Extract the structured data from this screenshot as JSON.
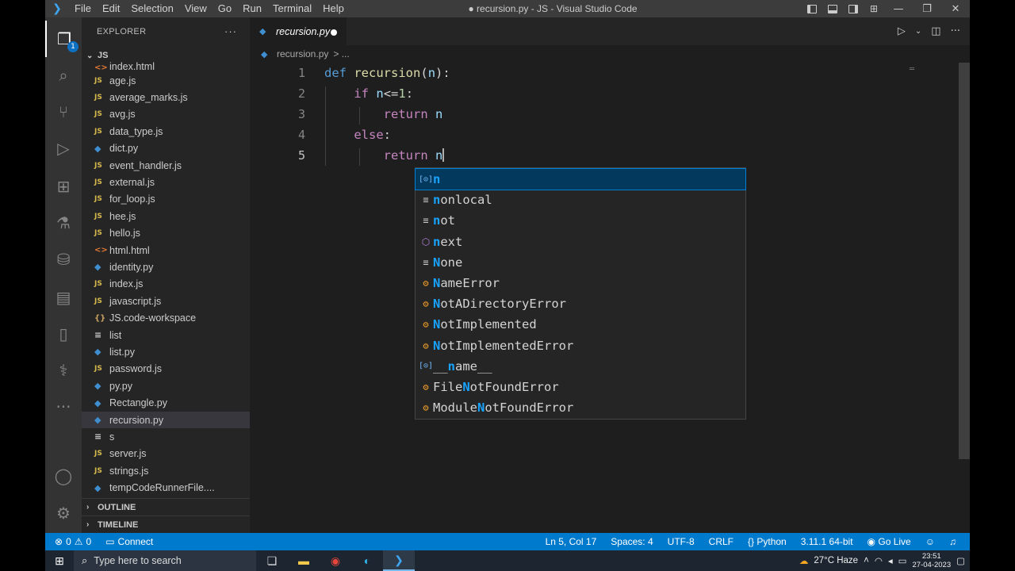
{
  "window": {
    "title": "● recursion.py - JS - Visual Studio Code",
    "menu": [
      "File",
      "Edit",
      "Selection",
      "View",
      "Go",
      "Run",
      "Terminal",
      "Help"
    ]
  },
  "activity_bar": {
    "explorer_badge": "1",
    "items": [
      "files-icon",
      "search-icon",
      "source-control-icon",
      "run-debug-icon",
      "extensions-icon",
      "testing-icon",
      "database-icon",
      "remote-explorer-icon",
      "bookmark-icon",
      "python-icon",
      "more-icon",
      "account-icon",
      "settings-gear-icon"
    ]
  },
  "sidebar": {
    "header": "EXPLORER",
    "folder": "JS",
    "files": [
      {
        "name": "index.html",
        "type": "html"
      },
      {
        "name": "age.js",
        "type": "js"
      },
      {
        "name": "average_marks.js",
        "type": "js"
      },
      {
        "name": "avg.js",
        "type": "js"
      },
      {
        "name": "data_type.js",
        "type": "js"
      },
      {
        "name": "dict.py",
        "type": "py"
      },
      {
        "name": "event_handler.js",
        "type": "js"
      },
      {
        "name": "external.js",
        "type": "js"
      },
      {
        "name": "for_loop.js",
        "type": "js"
      },
      {
        "name": "hee.js",
        "type": "js"
      },
      {
        "name": "hello.js",
        "type": "js"
      },
      {
        "name": "html.html",
        "type": "html"
      },
      {
        "name": "identity.py",
        "type": "py"
      },
      {
        "name": "index.js",
        "type": "js"
      },
      {
        "name": "javascript.js",
        "type": "js"
      },
      {
        "name": "JS.code-workspace",
        "type": "ws"
      },
      {
        "name": "list",
        "type": "plain"
      },
      {
        "name": "list.py",
        "type": "py"
      },
      {
        "name": "password.js",
        "type": "js"
      },
      {
        "name": "py.py",
        "type": "py"
      },
      {
        "name": "Rectangle.py",
        "type": "py"
      },
      {
        "name": "recursion.py",
        "type": "py",
        "active": true
      },
      {
        "name": "s",
        "type": "plain"
      },
      {
        "name": "server.js",
        "type": "js"
      },
      {
        "name": "strings.js",
        "type": "js"
      },
      {
        "name": "tempCodeRunnerFile....",
        "type": "py"
      }
    ],
    "outline": "OUTLINE",
    "timeline": "TIMELINE"
  },
  "editor": {
    "tab_label": "recursion.py",
    "breadcrumb_file": "recursion.py",
    "breadcrumb_rest": "> ...",
    "line_numbers": [
      "1",
      "2",
      "3",
      "4",
      "5"
    ],
    "code": {
      "l1_kw": "def",
      "l1_fn": "recursion",
      "l1_paren_open": "(",
      "l1_param": "n",
      "l1_paren_close": "):",
      "l2_kw": "if",
      "l2_var": "n",
      "l2_op": "<=",
      "l2_num": "1",
      "l2_colon": ":",
      "l3_kw": "return",
      "l3_var": "n",
      "l4_kw": "else",
      "l4_colon": ":",
      "l5_kw": "return",
      "l5_var": "n"
    }
  },
  "suggest": {
    "items": [
      {
        "kind": "variable",
        "prefix": "",
        "match": "n",
        "rest": ""
      },
      {
        "kind": "keyword",
        "prefix": "",
        "match": "n",
        "rest": "onlocal"
      },
      {
        "kind": "keyword",
        "prefix": "",
        "match": "n",
        "rest": "ot"
      },
      {
        "kind": "function",
        "prefix": "",
        "match": "n",
        "rest": "ext"
      },
      {
        "kind": "keyword",
        "prefix": "",
        "match": "N",
        "rest": "one"
      },
      {
        "kind": "class",
        "prefix": "",
        "match": "N",
        "rest": "ameError"
      },
      {
        "kind": "class",
        "prefix": "",
        "match": "N",
        "rest": "otADirectoryError"
      },
      {
        "kind": "class",
        "prefix": "",
        "match": "N",
        "rest": "otImplemented"
      },
      {
        "kind": "class",
        "prefix": "",
        "match": "N",
        "rest": "otImplementedError"
      },
      {
        "kind": "variable",
        "prefix": "__",
        "match": "n",
        "rest": "ame__"
      },
      {
        "kind": "class",
        "prefix": "File",
        "match": "N",
        "rest": "otFoundError"
      },
      {
        "kind": "class",
        "prefix": "Module",
        "match": "N",
        "rest": "otFoundError"
      }
    ]
  },
  "statusbar": {
    "errors": "0",
    "warnings": "0",
    "connect": "Connect",
    "position": "Ln 5, Col 17",
    "spaces": "Spaces: 4",
    "encoding": "UTF-8",
    "eol": "CRLF",
    "language": "Python",
    "interpreter": "3.11.1 64-bit",
    "golive": "Go Live"
  },
  "taskbar": {
    "search_placeholder": "Type here to search",
    "weather": "27°C Haze",
    "time": "23:51",
    "date": "27-04-2023"
  },
  "colors": {
    "accent": "#007acc",
    "editor_bg": "#1e1e1e",
    "keyword": "#569cd6",
    "function": "#dcdcaa",
    "variable": "#9cdcfe",
    "suggest_highlight": "#18a3ff"
  }
}
